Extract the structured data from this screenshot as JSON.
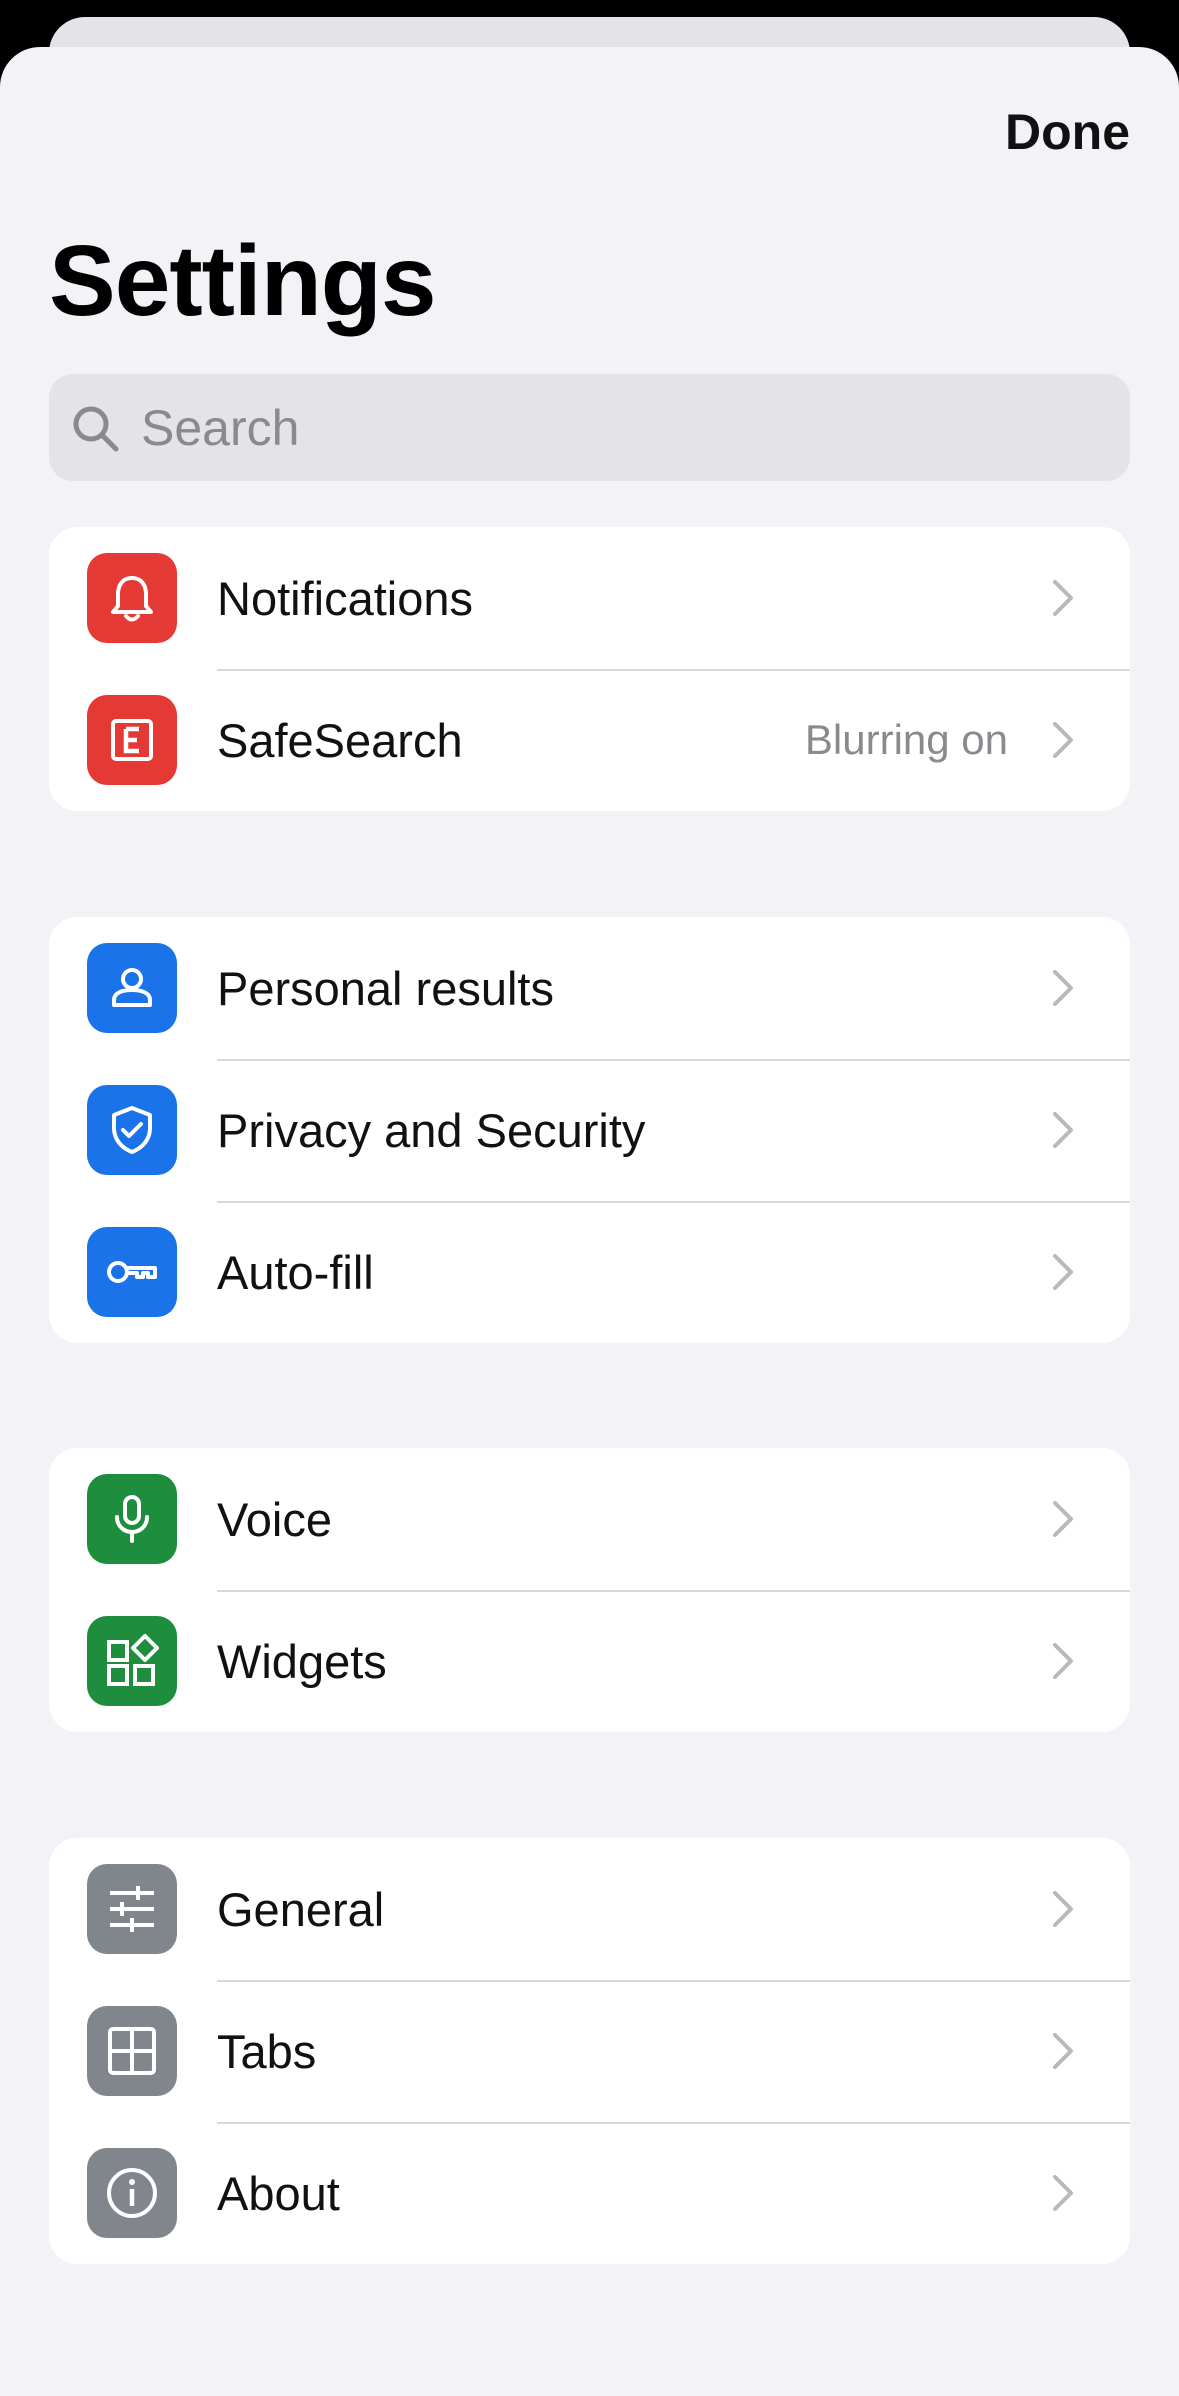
{
  "header": {
    "done_label": "Done",
    "title": "Settings"
  },
  "search": {
    "placeholder": "Search",
    "value": ""
  },
  "groups": [
    {
      "items": [
        {
          "label": "Notifications",
          "icon": "bell-icon",
          "color": "#e53935",
          "value": ""
        },
        {
          "label": "SafeSearch",
          "icon": "explicit-icon",
          "color": "#e53935",
          "value": "Blurring on"
        }
      ]
    },
    {
      "items": [
        {
          "label": "Personal results",
          "icon": "person-icon",
          "color": "#1a73e8",
          "value": ""
        },
        {
          "label": "Privacy and Security",
          "icon": "shield-check-icon",
          "color": "#1a73e8",
          "value": ""
        },
        {
          "label": "Auto-fill",
          "icon": "key-icon",
          "color": "#1a73e8",
          "value": ""
        }
      ]
    },
    {
      "items": [
        {
          "label": "Voice",
          "icon": "microphone-icon",
          "color": "#1e8e3e",
          "value": ""
        },
        {
          "label": "Widgets",
          "icon": "widgets-icon",
          "color": "#1e8e3e",
          "value": ""
        }
      ]
    },
    {
      "items": [
        {
          "label": "General",
          "icon": "sliders-icon",
          "color": "#80868b",
          "value": ""
        },
        {
          "label": "Tabs",
          "icon": "tabs-grid-icon",
          "color": "#80868b",
          "value": ""
        },
        {
          "label": "About",
          "icon": "info-icon",
          "color": "#80868b",
          "value": ""
        }
      ]
    }
  ]
}
